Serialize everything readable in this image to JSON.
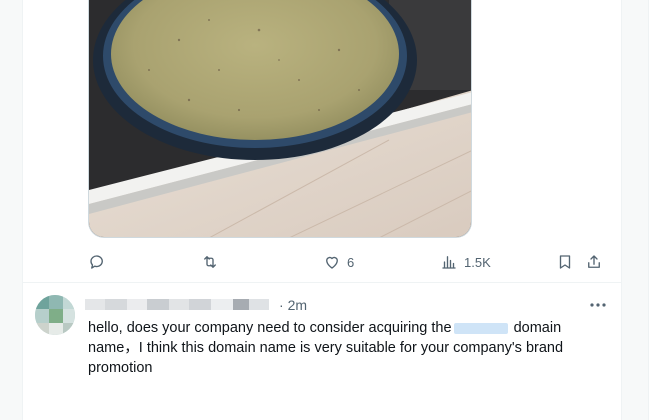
{
  "tweet": {
    "photo_alt": "bowl of green soup",
    "actions": {
      "reply_count": "",
      "retweet_count": "",
      "like_count": "6",
      "views_count": "1.5K"
    }
  },
  "reply": {
    "author_name": "",
    "separator": "·",
    "time": "2m",
    "text_part1": "hello, does your company need to consider acquiring the",
    "text_part2": "domain",
    "text_part3": "name，I think this domain name is very suitable for your company's brand promotion"
  },
  "colors": {
    "icon_gray": "#536471",
    "border": "#eff3f4",
    "redaction": "#cfe4f7"
  }
}
